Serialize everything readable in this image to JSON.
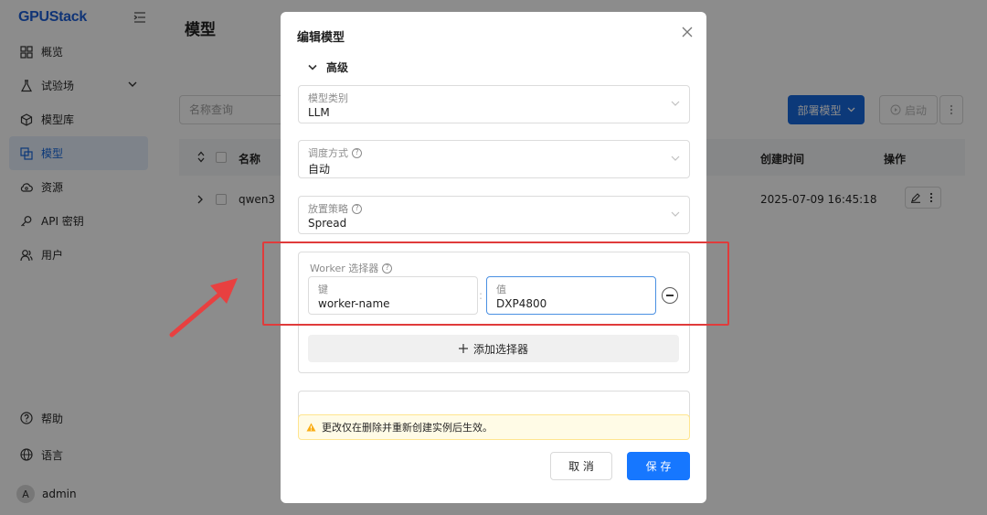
{
  "sidebar": {
    "logo_main": "GPU",
    "logo_rest": "Stack",
    "items": [
      {
        "label": "概览",
        "icon": "grid-icon"
      },
      {
        "label": "试验场",
        "icon": "flask-icon"
      },
      {
        "label": "模型库",
        "icon": "cube-icon"
      },
      {
        "label": "模型",
        "icon": "model-icon"
      },
      {
        "label": "资源",
        "icon": "cloud-icon"
      },
      {
        "label": "API 密钥",
        "icon": "key-icon"
      },
      {
        "label": "用户",
        "icon": "user-icon"
      }
    ],
    "help": "帮助",
    "language": "语言",
    "user": {
      "initial": "A",
      "name": "admin"
    }
  },
  "main": {
    "title": "模型",
    "search_placeholder": "名称查询",
    "deploy_label": "部署模型",
    "start_label": "启动",
    "columns": {
      "name": "名称",
      "created": "创建时间",
      "actions": "操作"
    },
    "row": {
      "name": "qwen3",
      "created": "2025-07-09 16:45:18"
    }
  },
  "modal": {
    "title": "编辑模型",
    "section": "高级",
    "model_type": {
      "label": "模型类别",
      "value": "LLM"
    },
    "schedule": {
      "label": "调度方式",
      "value": "自动"
    },
    "placement": {
      "label": "放置策略",
      "value": "Spread"
    },
    "selector": {
      "title": "Worker 选择器",
      "key_label": "键",
      "key_value": "worker-name",
      "value_label": "值",
      "value_value": "DXP4800",
      "separator": ":",
      "add_label": "添加选择器"
    },
    "warning": "更改仅在删除并重新创建实例后生效。",
    "cancel": "取 消",
    "save": "保 存"
  },
  "colors": {
    "primary": "#1677ff",
    "annotation": "#e03b3b",
    "warning_bg": "#fffbe6"
  }
}
